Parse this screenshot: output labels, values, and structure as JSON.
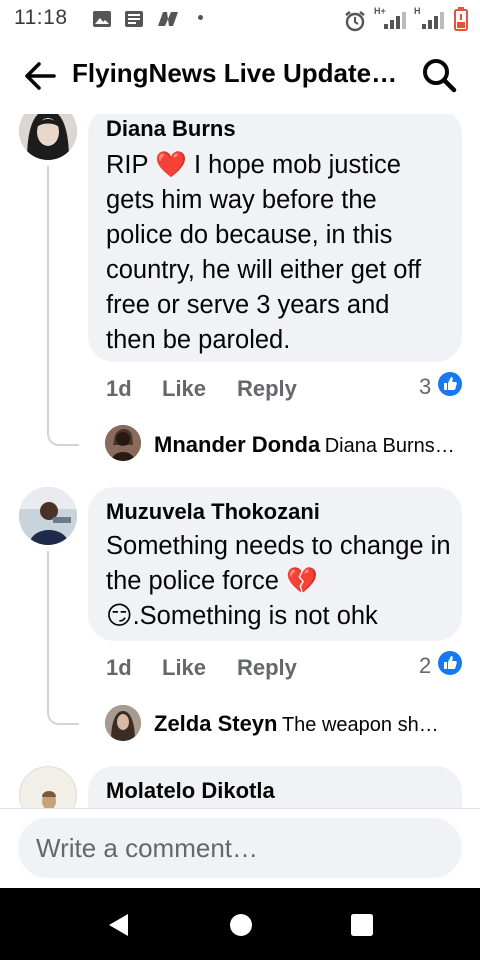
{
  "status_bar": {
    "time": "11:18",
    "left_icons": [
      "image-icon",
      "news-icon",
      "flyingnews-app-icon"
    ],
    "right_icons": [
      "alarm-icon",
      "signal-hplus-icon",
      "signal-h-icon",
      "battery-low-icon"
    ],
    "network_labels": [
      "H+",
      "H"
    ]
  },
  "app_bar": {
    "title": "FlyingNews Live Update…"
  },
  "comments": [
    {
      "author": "Diana Burns",
      "text": "RIP ❤️ I hope mob justice gets him way before the police do because, in this country, he will either get off free or serve 3 years and then be paroled.",
      "time": "1d",
      "like_label": "Like",
      "reply_label": "Reply",
      "reaction_count": "3",
      "reply_preview": {
        "author": "Mnander Donda",
        "text": "Diana Burns…"
      }
    },
    {
      "author": "Muzuvela Thokozani",
      "text": "Something needs to change in the police force 💔😏.Something is not ohk",
      "time": "1d",
      "like_label": "Like",
      "reply_label": "Reply",
      "reaction_count": "2",
      "reply_preview": {
        "author": "Zelda Steyn",
        "text": "The weapon sh…"
      }
    },
    {
      "author": "Molatelo Dikotla"
    }
  ],
  "composer": {
    "placeholder": "Write a comment…"
  },
  "nav": {
    "icons": [
      "back-triangle-icon",
      "home-circle-icon",
      "recents-square-icon"
    ]
  },
  "colors": {
    "bubble": "#f0f2f5",
    "secondary_text": "#65676b",
    "like_blue": "#1877f2",
    "heart_red": "#e8192c",
    "nav_bar": "#000000"
  }
}
